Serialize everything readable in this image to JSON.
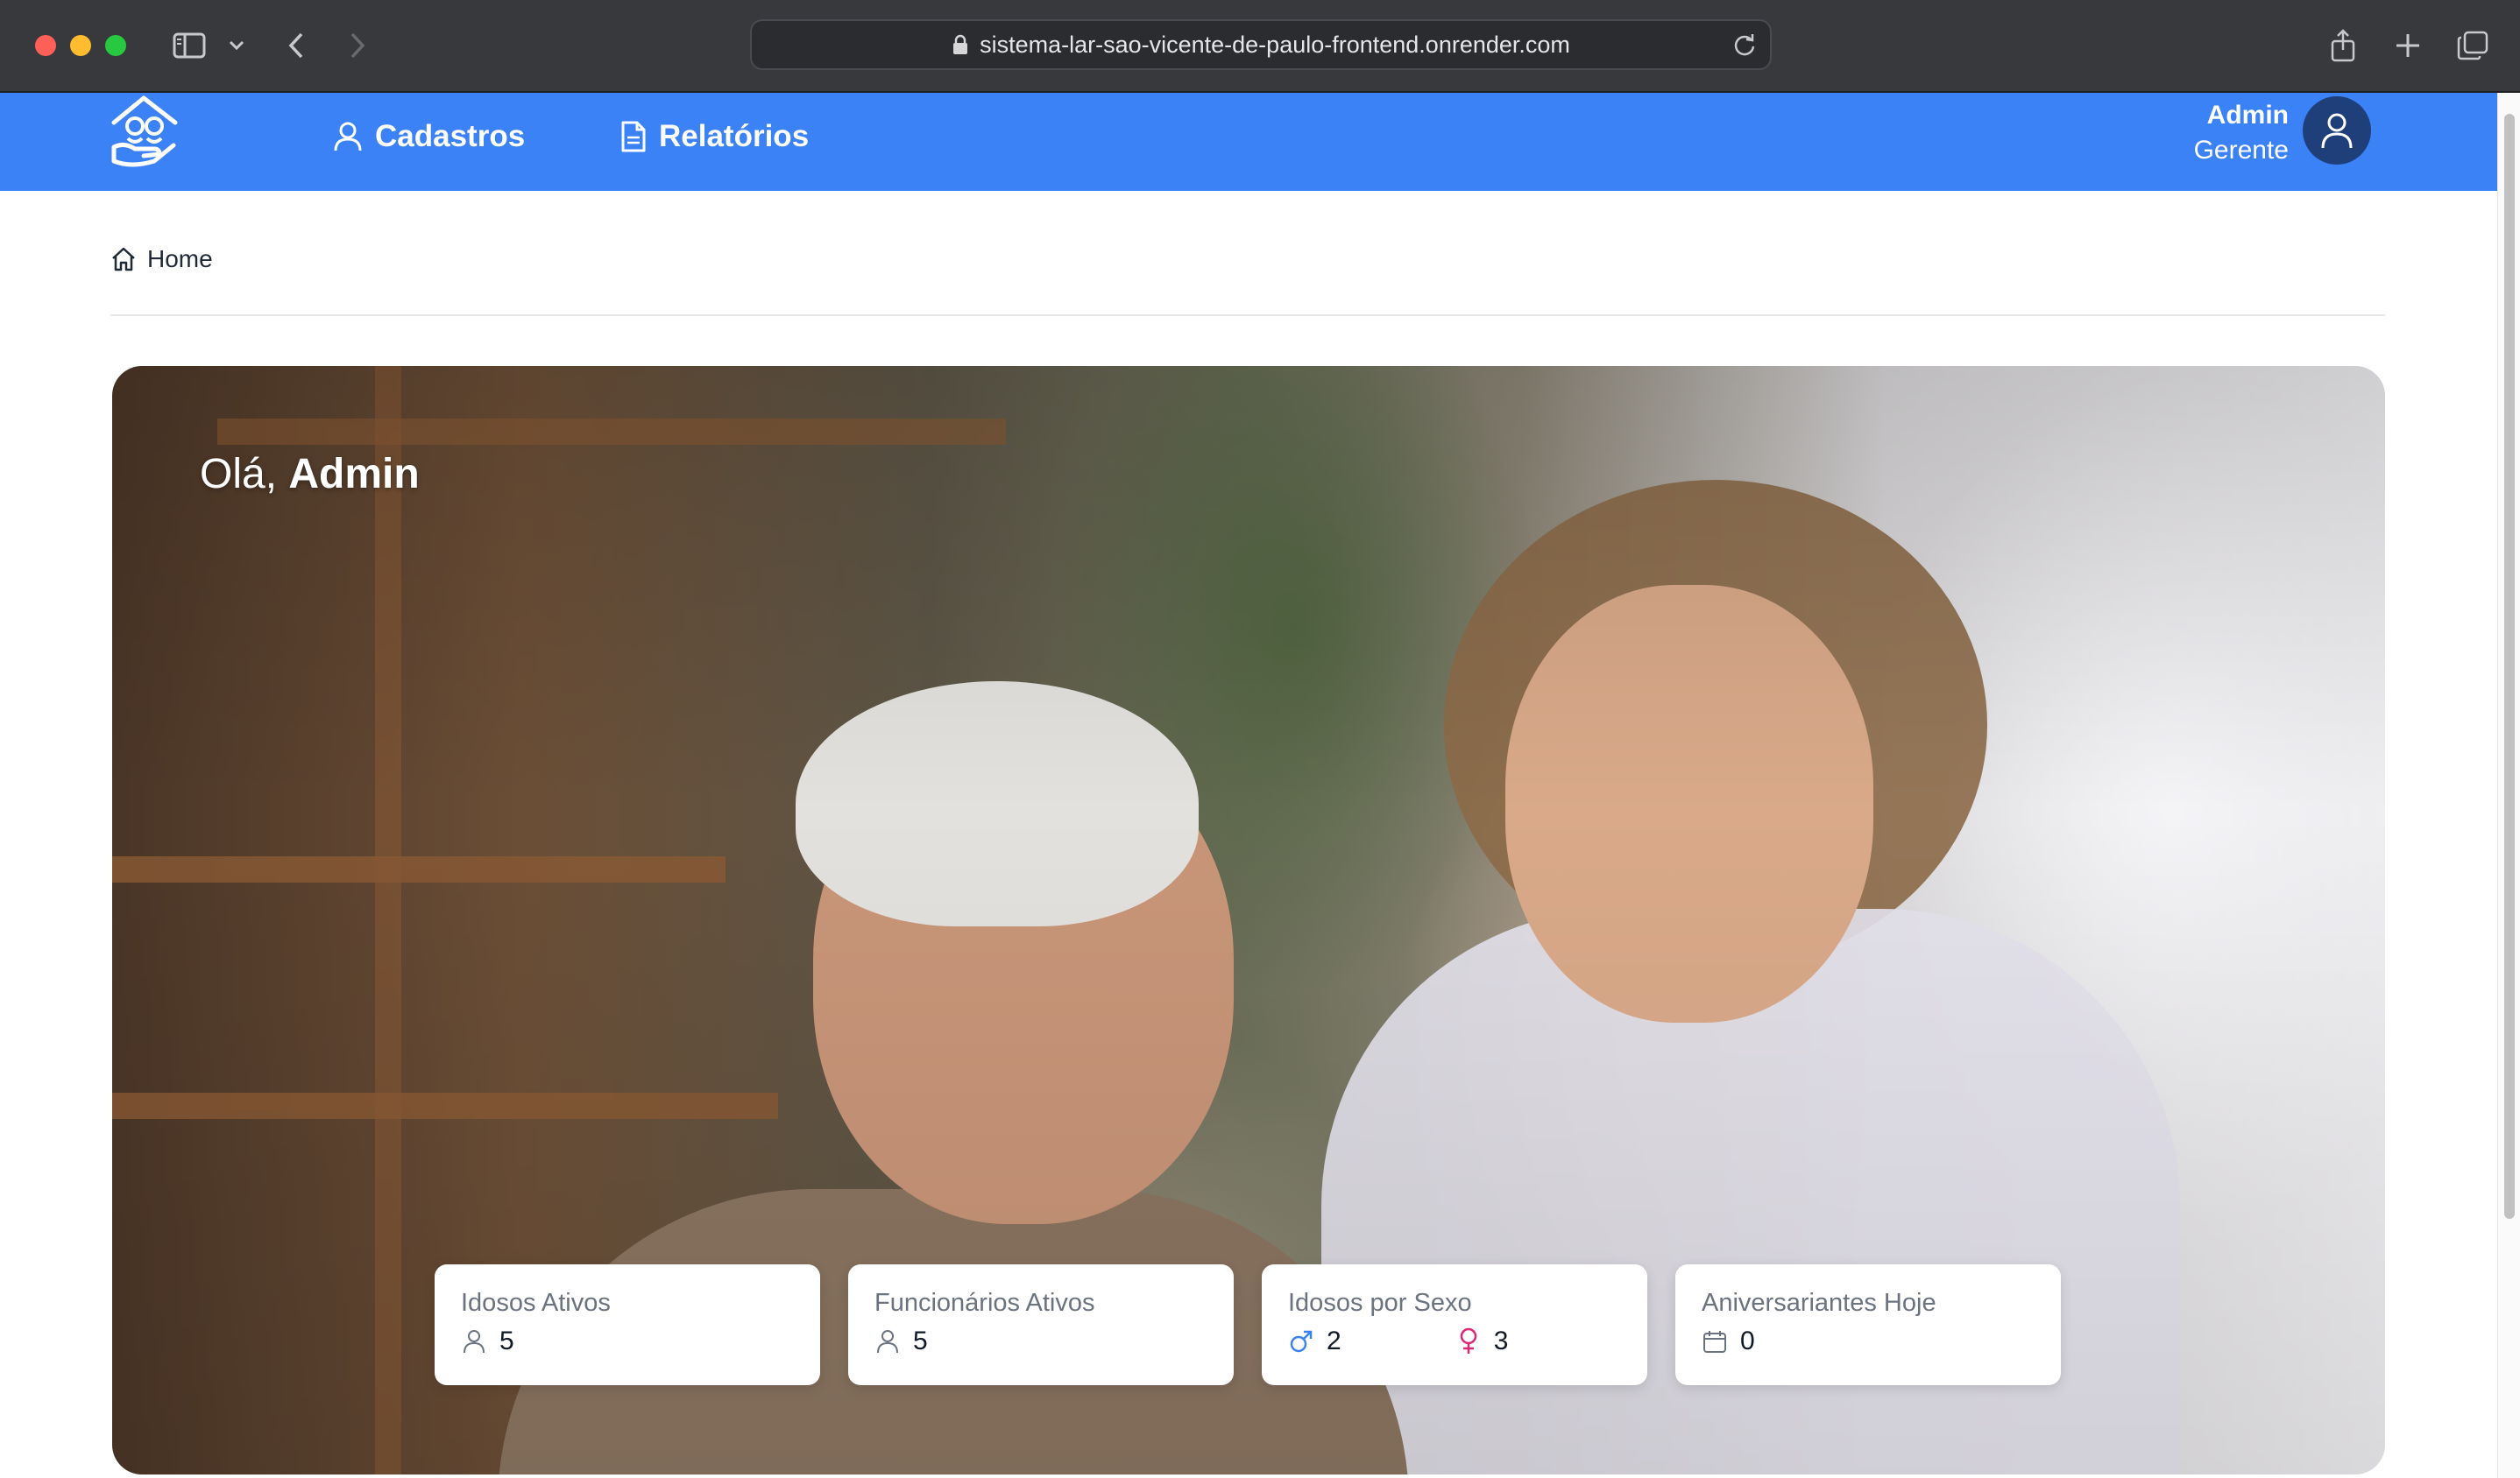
{
  "browser": {
    "url": "sistema-lar-sao-vicente-de-paulo-frontend.onrender.com"
  },
  "nav": {
    "items": [
      {
        "label": "Cadastros",
        "icon": "user-icon"
      },
      {
        "label": "Relatórios",
        "icon": "document-icon"
      }
    ],
    "user": {
      "name": "Admin",
      "role": "Gerente",
      "icon": "user-avatar-icon"
    }
  },
  "breadcrumb": {
    "label": "Home",
    "icon": "home-icon"
  },
  "hero": {
    "greeting_prefix": "Olá,",
    "greeting_name": "Admin"
  },
  "stats": [
    {
      "title": "Idosos Ativos",
      "icon": "user-icon",
      "value": "5"
    },
    {
      "title": "Funcionários Ativos",
      "icon": "user-icon",
      "value": "5"
    },
    {
      "title": "Idosos por Sexo",
      "male_icon": "male-icon",
      "male_value": "2",
      "female_icon": "female-icon",
      "female_value": "3",
      "male_color": "#3b82f6",
      "female_color": "#db2777"
    },
    {
      "title": "Aniversariantes Hoje",
      "icon": "calendar-icon",
      "value": "0"
    }
  ],
  "colors": {
    "brand": "#3b82f6",
    "avatar": "#1f3f7a"
  }
}
